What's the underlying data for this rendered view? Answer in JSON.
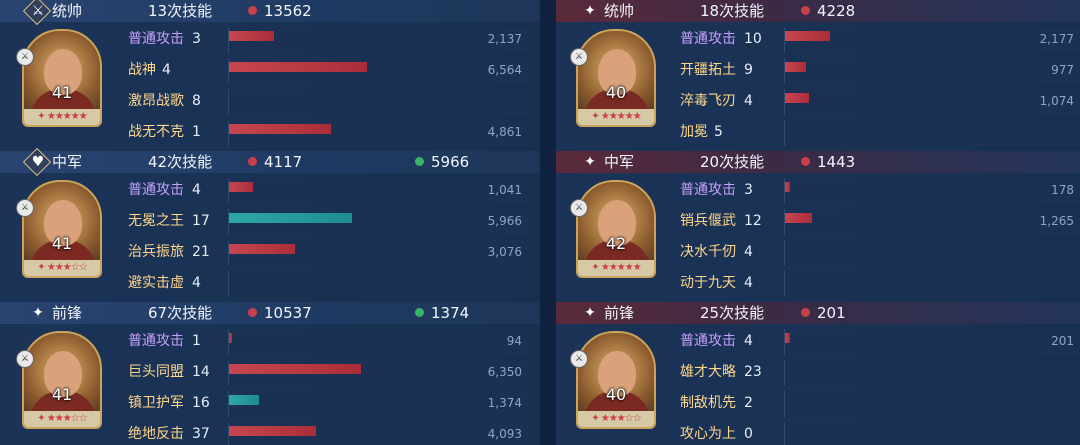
{
  "left": [
    {
      "role": "统帅",
      "role_icon": "sword-icon",
      "casts": "13次技能",
      "dmg": "13562",
      "heal": null,
      "level": "41",
      "star_count": 5,
      "skills": [
        {
          "name": "普通攻击",
          "basic": true,
          "count": "3",
          "value": "2,137",
          "bar": 0.15,
          "color": "red"
        },
        {
          "name": "战神",
          "basic": false,
          "count": "4",
          "value": "6,564",
          "bar": 0.46,
          "color": "red"
        },
        {
          "name": "激昂战歌",
          "basic": false,
          "count": "8",
          "value": "",
          "bar": 0,
          "color": "red"
        },
        {
          "name": "战无不克",
          "basic": false,
          "count": "1",
          "value": "4,861",
          "bar": 0.34,
          "color": "red"
        }
      ]
    },
    {
      "role": "中军",
      "role_icon": "heart-icon",
      "casts": "42次技能",
      "dmg": "4117",
      "heal": "5966",
      "level": "41",
      "star_count": 3,
      "skills": [
        {
          "name": "普通攻击",
          "basic": true,
          "count": "4",
          "value": "1,041",
          "bar": 0.08,
          "color": "red"
        },
        {
          "name": "无冕之王",
          "basic": false,
          "count": "17",
          "value": "5,966",
          "bar": 0.41,
          "color": "teal"
        },
        {
          "name": "治兵振旅",
          "basic": false,
          "count": "21",
          "value": "3,076",
          "bar": 0.22,
          "color": "red"
        },
        {
          "name": "避实击虚",
          "basic": false,
          "count": "4",
          "value": "",
          "bar": 0,
          "color": "red"
        }
      ]
    },
    {
      "role": "前锋",
      "role_icon": "spark-icon",
      "casts": "67次技能",
      "dmg": "10537",
      "heal": "1374",
      "level": "41",
      "star_count": 3,
      "skills": [
        {
          "name": "普通攻击",
          "basic": true,
          "count": "1",
          "value": "94",
          "bar": 0.01,
          "color": "red"
        },
        {
          "name": "巨头同盟",
          "basic": false,
          "count": "14",
          "value": "6,350",
          "bar": 0.44,
          "color": "red"
        },
        {
          "name": "镇卫护军",
          "basic": false,
          "count": "16",
          "value": "1,374",
          "bar": 0.1,
          "color": "teal"
        },
        {
          "name": "绝地反击",
          "basic": false,
          "count": "37",
          "value": "4,093",
          "bar": 0.29,
          "color": "red"
        }
      ]
    }
  ],
  "right": [
    {
      "role": "统帅",
      "role_icon": "spark-icon",
      "casts": "18次技能",
      "dmg": "4228",
      "level": "40",
      "star_count": 5,
      "skills": [
        {
          "name": "普通攻击",
          "basic": true,
          "count": "10",
          "value": "2,177",
          "bar": 0.15,
          "color": "red"
        },
        {
          "name": "开疆拓土",
          "basic": false,
          "count": "9",
          "value": "977",
          "bar": 0.07,
          "color": "red"
        },
        {
          "name": "淬毒飞刃",
          "basic": false,
          "count": "4",
          "value": "1,074",
          "bar": 0.08,
          "color": "red"
        },
        {
          "name": "加冕",
          "basic": false,
          "count": "5",
          "value": "",
          "bar": 0,
          "color": "red"
        }
      ]
    },
    {
      "role": "中军",
      "role_icon": "spark-icon",
      "casts": "20次技能",
      "dmg": "1443",
      "level": "42",
      "star_count": 5,
      "skills": [
        {
          "name": "普通攻击",
          "basic": true,
          "count": "3",
          "value": "178",
          "bar": 0.015,
          "color": "red"
        },
        {
          "name": "销兵偃武",
          "basic": false,
          "count": "12",
          "value": "1,265",
          "bar": 0.09,
          "color": "red"
        },
        {
          "name": "决水千仞",
          "basic": false,
          "count": "4",
          "value": "",
          "bar": 0,
          "color": "red"
        },
        {
          "name": "动于九天",
          "basic": false,
          "count": "4",
          "value": "",
          "bar": 0,
          "color": "red"
        }
      ]
    },
    {
      "role": "前锋",
      "role_icon": "spark-icon",
      "casts": "25次技能",
      "dmg": "201",
      "level": "40",
      "star_count": 3,
      "skills": [
        {
          "name": "普通攻击",
          "basic": true,
          "count": "4",
          "value": "201",
          "bar": 0.015,
          "color": "red"
        },
        {
          "name": "雄才大略",
          "basic": false,
          "count": "23",
          "value": "",
          "bar": 0,
          "color": "red"
        },
        {
          "name": "制敌机先",
          "basic": false,
          "count": "2",
          "value": "",
          "bar": 0,
          "color": "red"
        },
        {
          "name": "攻心为上",
          "basic": false,
          "count": "0",
          "value": "",
          "bar": 0,
          "color": "red"
        }
      ]
    }
  ]
}
